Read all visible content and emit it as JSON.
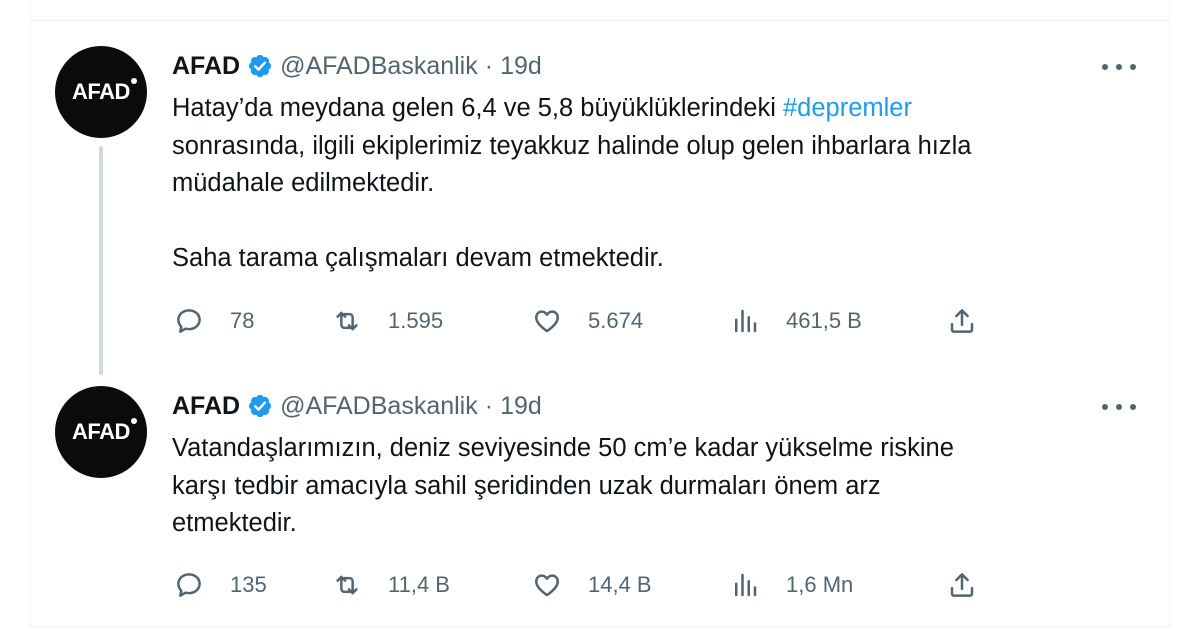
{
  "tweets": [
    {
      "author": {
        "name": "AFAD",
        "handle": "@AFADBaskanlik",
        "separator": "·",
        "time": "19d",
        "avatar_text": "AFAD"
      },
      "text_before_hashtag": "Hatay’da meydana gelen 6,4 ve 5,8 büyüklüklerindeki ",
      "hashtag": "#depremler",
      "text_after_hashtag": "\nsonrasında, ilgili ekiplerimiz teyakkuz halinde olup gelen ihbarlara hızla\nmüdahale edilmektedir.\n\nSaha tarama çalışmaları devam etmektedir.",
      "stats": {
        "replies": "78",
        "retweets": "1.595",
        "likes": "5.674",
        "views": "461,5 B"
      }
    },
    {
      "author": {
        "name": "AFAD",
        "handle": "@AFADBaskanlik",
        "separator": "·",
        "time": "19d",
        "avatar_text": "AFAD"
      },
      "text_before_hashtag": "Vatandaşlarımızın, deniz seviyesinde 50 cm’e kadar yükselme riskine\nkarşı tedbir amacıyla sahil şeridinden uzak durmaları önem arz\netmektedir.",
      "hashtag": "",
      "text_after_hashtag": "",
      "stats": {
        "replies": "135",
        "retweets": "11,4 B",
        "likes": "14,4 B",
        "views": "1,6 Mn"
      }
    }
  ],
  "colors": {
    "text": "#0f1419",
    "secondary": "#536471",
    "link": "#1d9bf0",
    "verified": "#1d9bf0",
    "thread_line": "#cfd9de"
  },
  "icons": [
    "reply-icon",
    "retweet-icon",
    "like-icon",
    "views-icon",
    "share-icon",
    "verified-badge-icon",
    "more-icon"
  ]
}
